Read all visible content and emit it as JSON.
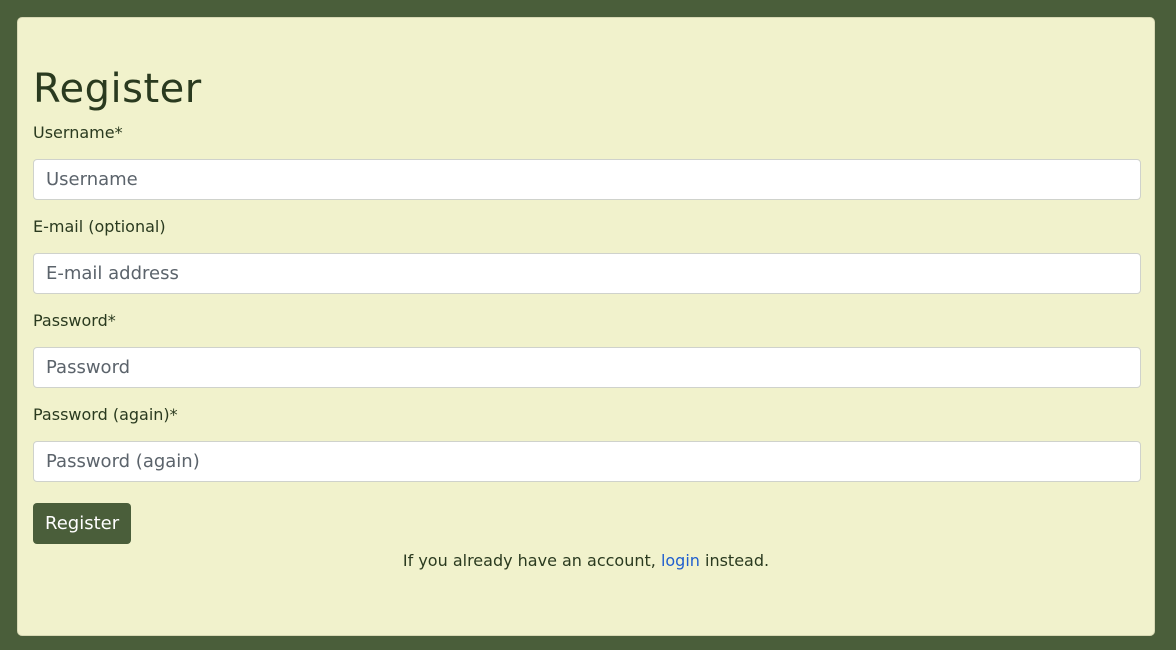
{
  "page": {
    "title": "Register",
    "colors": {
      "background": "#4a5e3a",
      "card": "#f1f2cc",
      "primary_button": "#4a5e3a",
      "link": "#1f5fcf"
    }
  },
  "form": {
    "fields": [
      {
        "label": "Username*",
        "placeholder": "Username",
        "value": ""
      },
      {
        "label": "E-mail (optional)",
        "placeholder": "E-mail address",
        "value": ""
      },
      {
        "label": "Password*",
        "placeholder": "Password",
        "value": ""
      },
      {
        "label": "Password (again)*",
        "placeholder": "Password (again)",
        "value": ""
      }
    ],
    "submit_label": "Register"
  },
  "footer": {
    "prefix": "If you already have an account, ",
    "link_label": "login",
    "suffix": " instead."
  }
}
